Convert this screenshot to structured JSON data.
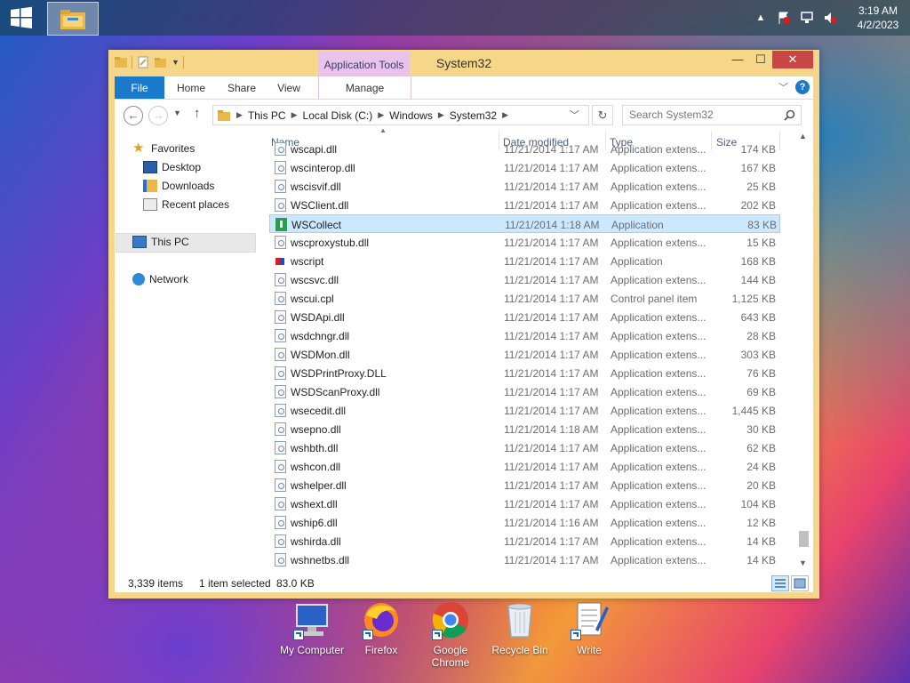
{
  "taskbar": {
    "start_icon": "windows-logo",
    "app_icon": "file-explorer",
    "clock": {
      "time": "3:19 AM",
      "date": "4/2/2023"
    },
    "tray_icons": [
      "chevron-up-icon",
      "action-center-flag-icon",
      "network-icon",
      "volume-muted-icon"
    ]
  },
  "window": {
    "title": "System32",
    "app_tools_label": "Application Tools",
    "ribbon_tabs": [
      "File",
      "Home",
      "Share",
      "View",
      "Manage"
    ],
    "breadcrumbs": [
      "This PC",
      "Local Disk (C:)",
      "Windows",
      "System32"
    ],
    "search_placeholder": "Search System32",
    "nav": {
      "favorites": "Favorites",
      "desktop": "Desktop",
      "downloads": "Downloads",
      "recent": "Recent places",
      "thispc": "This PC",
      "network": "Network"
    },
    "columns": {
      "name": "Name",
      "date": "Date modified",
      "type": "Type",
      "size": "Size"
    },
    "files": [
      {
        "name": "wscapi.dll",
        "date": "11/21/2014 1:17 AM",
        "type": "Application extens...",
        "size": "174 KB",
        "icon": "dll"
      },
      {
        "name": "wscinterop.dll",
        "date": "11/21/2014 1:17 AM",
        "type": "Application extens...",
        "size": "167 KB",
        "icon": "dll"
      },
      {
        "name": "wscisvif.dll",
        "date": "11/21/2014 1:17 AM",
        "type": "Application extens...",
        "size": "25 KB",
        "icon": "dll"
      },
      {
        "name": "WSClient.dll",
        "date": "11/21/2014 1:17 AM",
        "type": "Application extens...",
        "size": "202 KB",
        "icon": "dll"
      },
      {
        "name": "WSCollect",
        "date": "11/21/2014 1:18 AM",
        "type": "Application",
        "size": "83 KB",
        "icon": "app",
        "selected": true
      },
      {
        "name": "wscproxystub.dll",
        "date": "11/21/2014 1:17 AM",
        "type": "Application extens...",
        "size": "15 KB",
        "icon": "dll"
      },
      {
        "name": "wscript",
        "date": "11/21/2014 1:17 AM",
        "type": "Application",
        "size": "168 KB",
        "icon": "script"
      },
      {
        "name": "wscsvc.dll",
        "date": "11/21/2014 1:17 AM",
        "type": "Application extens...",
        "size": "144 KB",
        "icon": "dll"
      },
      {
        "name": "wscui.cpl",
        "date": "11/21/2014 1:17 AM",
        "type": "Control panel item",
        "size": "1,125 KB",
        "icon": "dll"
      },
      {
        "name": "WSDApi.dll",
        "date": "11/21/2014 1:17 AM",
        "type": "Application extens...",
        "size": "643 KB",
        "icon": "dll"
      },
      {
        "name": "wsdchngr.dll",
        "date": "11/21/2014 1:17 AM",
        "type": "Application extens...",
        "size": "28 KB",
        "icon": "dll"
      },
      {
        "name": "WSDMon.dll",
        "date": "11/21/2014 1:17 AM",
        "type": "Application extens...",
        "size": "303 KB",
        "icon": "dll"
      },
      {
        "name": "WSDPrintProxy.DLL",
        "date": "11/21/2014 1:17 AM",
        "type": "Application extens...",
        "size": "76 KB",
        "icon": "dll"
      },
      {
        "name": "WSDScanProxy.dll",
        "date": "11/21/2014 1:17 AM",
        "type": "Application extens...",
        "size": "69 KB",
        "icon": "dll"
      },
      {
        "name": "wsecedit.dll",
        "date": "11/21/2014 1:17 AM",
        "type": "Application extens...",
        "size": "1,445 KB",
        "icon": "dll"
      },
      {
        "name": "wsepno.dll",
        "date": "11/21/2014 1:18 AM",
        "type": "Application extens...",
        "size": "30 KB",
        "icon": "dll"
      },
      {
        "name": "wshbth.dll",
        "date": "11/21/2014 1:17 AM",
        "type": "Application extens...",
        "size": "62 KB",
        "icon": "dll"
      },
      {
        "name": "wshcon.dll",
        "date": "11/21/2014 1:17 AM",
        "type": "Application extens...",
        "size": "24 KB",
        "icon": "dll"
      },
      {
        "name": "wshelper.dll",
        "date": "11/21/2014 1:17 AM",
        "type": "Application extens...",
        "size": "20 KB",
        "icon": "dll"
      },
      {
        "name": "wshext.dll",
        "date": "11/21/2014 1:17 AM",
        "type": "Application extens...",
        "size": "104 KB",
        "icon": "dll"
      },
      {
        "name": "wship6.dll",
        "date": "11/21/2014 1:16 AM",
        "type": "Application extens...",
        "size": "12 KB",
        "icon": "dll"
      },
      {
        "name": "wshirda.dll",
        "date": "11/21/2014 1:17 AM",
        "type": "Application extens...",
        "size": "14 KB",
        "icon": "dll"
      },
      {
        "name": "wshnetbs.dll",
        "date": "11/21/2014 1:17 AM",
        "type": "Application extens...",
        "size": "14 KB",
        "icon": "dll"
      }
    ],
    "status": {
      "items": "3,339 items",
      "selected": "1 item selected",
      "size": "83.0 KB"
    }
  },
  "desktop": {
    "icons": [
      {
        "label": "My Computer",
        "icon": "computer-icon"
      },
      {
        "label": "Firefox",
        "icon": "firefox-icon"
      },
      {
        "label": "Google Chrome",
        "icon": "chrome-icon"
      },
      {
        "label": "Recycle Bin",
        "icon": "recycle-bin-icon"
      },
      {
        "label": "Write",
        "icon": "write-icon"
      }
    ]
  }
}
